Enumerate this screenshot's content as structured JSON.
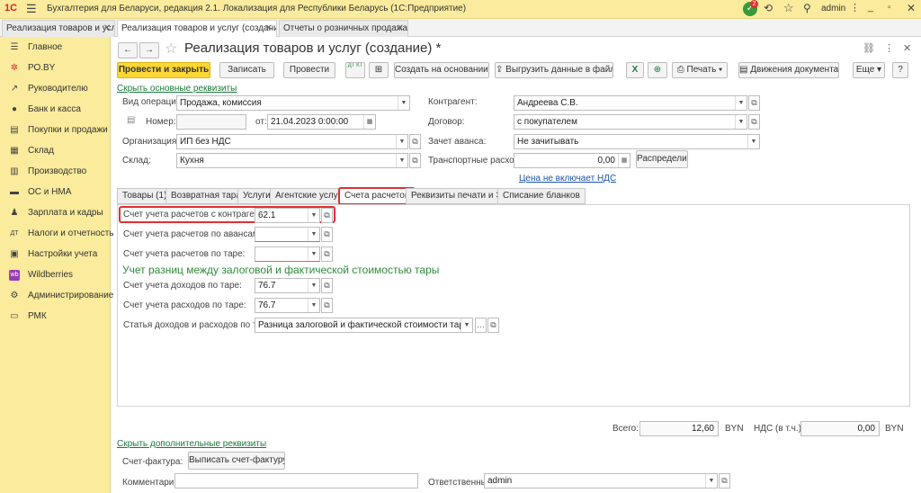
{
  "app_title": "Бухгалтерия для Беларуси, редакция 2.1. Локализация для Республики Беларусь (1С:Предприятие)",
  "notification_count": "2",
  "user": "admin",
  "tabs": [
    "Реализация товаров и услуг",
    "Реализация товаров и услуг (создание) *",
    "Отчеты о розничных продажах"
  ],
  "sidebar": [
    "Главное",
    "РО.BY",
    "Руководителю",
    "Банк и касса",
    "Покупки и продажи",
    "Склад",
    "Производство",
    "ОС и НМА",
    "Зарплата и кадры",
    "Налоги и отчетность",
    "Настройки учета",
    "Wildberries",
    "Администрирование",
    "РМК"
  ],
  "doc_title": "Реализация товаров и услуг (создание) *",
  "toolbar": {
    "post_close": "Провести и закрыть",
    "save": "Записать",
    "post": "Провести",
    "dtkt": "ДТ КТ",
    "create_based": "Создать на основании",
    "export": "Выгрузить данные в файл",
    "print": "Печать",
    "movements": "Движения документа",
    "more": "Еще",
    "help": "?"
  },
  "hide_main_link": "Скрыть основные реквизиты",
  "form": {
    "op_label": "Вид операции:",
    "op_value": "Продажа, комиссия",
    "num_label": "Номер:",
    "num_value": "",
    "from_label": "от:",
    "date_value": "21.04.2023  0:00:00",
    "org_label": "Организация:",
    "org_value": "ИП без НДС",
    "warehouse_label": "Склад:",
    "warehouse_value": "Кухня",
    "counterparty_label": "Контрагент:",
    "counterparty_value": "Андреева С.В.",
    "contract_label": "Договор:",
    "contract_value": "с покупателем",
    "advance_label": "Зачет аванса:",
    "advance_value": "Не зачитывать",
    "transport_label": "Транспортные расходы:",
    "transport_value": "0,00",
    "distribute": "Распределить",
    "price_link": "Цена не включает НДС"
  },
  "form_tabs": [
    "Товары (1)",
    "Возвратная тара",
    "Услуги",
    "Агентские услуги",
    "Счета расчетов",
    "Реквизиты печати и ЭД",
    "Списание бланков"
  ],
  "accounts": {
    "contractor_label": "Счет учета расчетов с контрагентом:",
    "contractor_value": "62.1",
    "advance_label": "Счет учета расчетов по авансам:",
    "advance_value": "",
    "tare_label": "Счет учета расчетов по таре:",
    "tare_value": "",
    "section_title": "Учет разниц между залоговой и фактической стоимостью тары",
    "income_label": "Счет учета доходов по таре:",
    "income_value": "76.7",
    "expense_label": "Счет учета расходов по таре:",
    "expense_value": "76.7",
    "article_label": "Статья доходов и расходов по таре:",
    "article_value": "Разница залоговой и фактической стоимости тары"
  },
  "totals": {
    "total_label": "Всего:",
    "total_value": "12,60",
    "currency": "BYN",
    "vat_label": "НДС (в т.ч.):",
    "vat_value": "0,00",
    "vat_currency": "BYN"
  },
  "hide_extra_link": "Скрыть дополнительные реквизиты",
  "invoice_label": "Счет-фактура:",
  "invoice_button": "Выписать счет-фактуру",
  "comment_label": "Комментарий:",
  "comment_value": "",
  "responsible_label": "Ответственный:",
  "responsible_value": "admin",
  "colors": {
    "accent_yellow": "#fcd735",
    "sidebar": "#fbeb9c",
    "link_green": "#1a7a3a",
    "highlight_red": "#e03030"
  }
}
